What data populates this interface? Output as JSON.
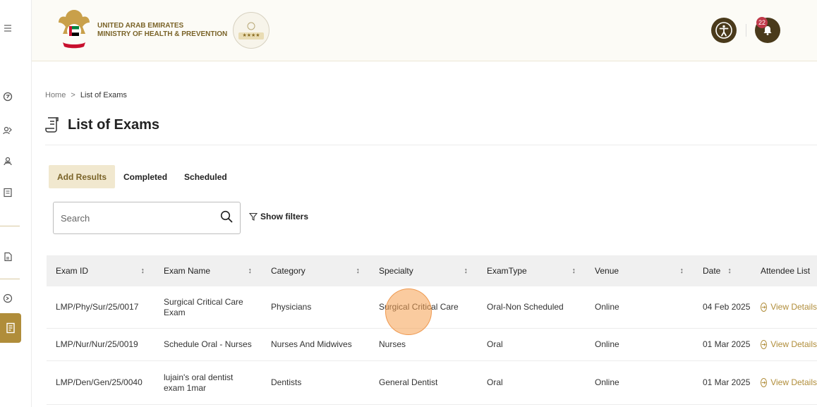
{
  "header": {
    "ministry_line1": "UNITED ARAB EMIRATES",
    "ministry_line2": "MINISTRY OF HEALTH & PREVENTION",
    "notification_count": "22",
    "brand_color": "#b08d3a"
  },
  "breadcrumb": {
    "home": "Home",
    "separator": ">",
    "current": "List of Exams"
  },
  "page": {
    "title": "List of Exams"
  },
  "tabs": [
    {
      "label": "Add Results",
      "active": true
    },
    {
      "label": "Completed"
    },
    {
      "label": "Scheduled"
    }
  ],
  "search": {
    "placeholder": "Search",
    "value": ""
  },
  "filters": {
    "label": "Show filters"
  },
  "table": {
    "columns": [
      "Exam ID",
      "Exam Name",
      "Category",
      "Specialty",
      "ExamType",
      "Venue",
      "Date",
      "Attendee List"
    ],
    "rows": [
      {
        "exam_id": "LMP/Phy/Sur/25/0017",
        "exam_name": "Surgical Critical Care Exam",
        "category": "Physicians",
        "specialty": "Surgical Critical Care",
        "exam_type": "Oral-Non Scheduled",
        "venue": "Online",
        "date": "04 Feb 2025",
        "attendee": "View Details"
      },
      {
        "exam_id": "LMP/Nur/Nur/25/0019",
        "exam_name": "Schedule Oral - Nurses",
        "category": "Nurses And Midwives",
        "specialty": "Nurses",
        "exam_type": "Oral",
        "venue": "Online",
        "date": "01 Mar 2025",
        "attendee": "View Details"
      },
      {
        "exam_id": "LMP/Den/Gen/25/0040",
        "exam_name": "lujain's oral dentist exam 1mar",
        "category": "Dentists",
        "specialty": "General Dentist",
        "exam_type": "Oral",
        "venue": "Online",
        "date": "01 Mar 2025",
        "attendee": "View Details"
      }
    ]
  }
}
